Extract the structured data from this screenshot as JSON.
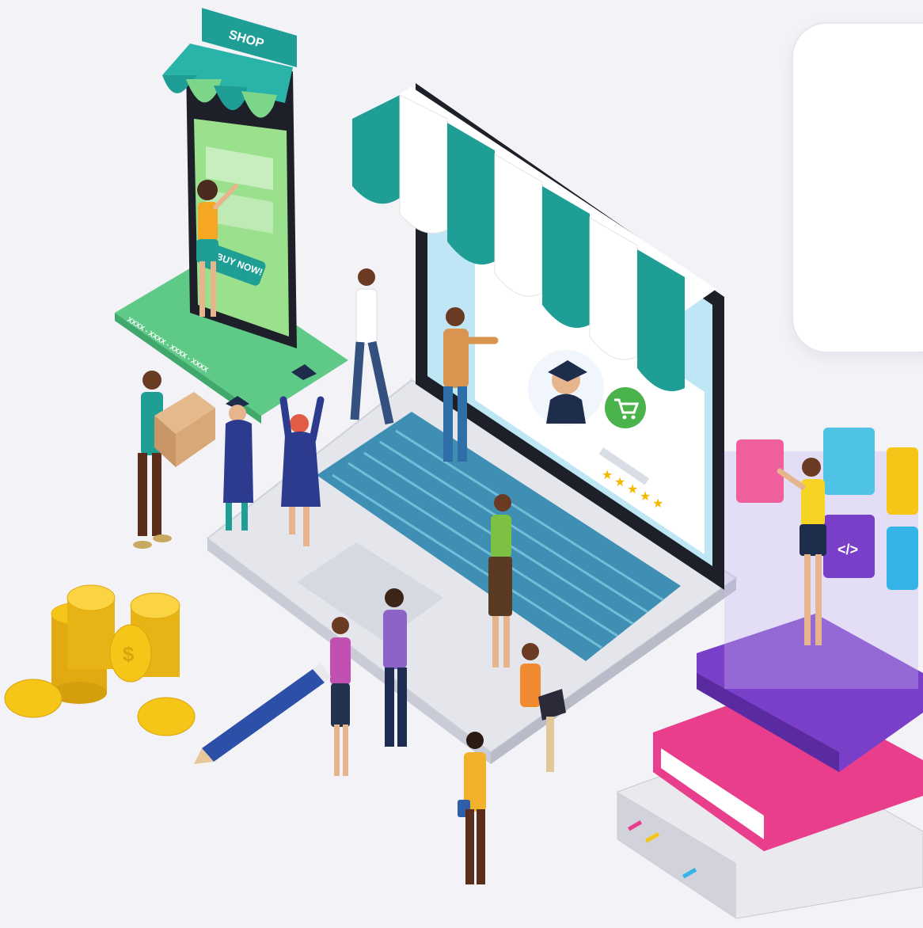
{
  "illustration": {
    "shop_sign": "SHOP",
    "buy_now_label": "BUY NOW!",
    "card_number": "XXXX - XXXX - XXXX - XXXX",
    "rating_stars": 5,
    "coin_symbol": "$"
  },
  "colors": {
    "background": "#f3f3f7",
    "awning_teal": "#1e9e95",
    "awning_white": "#ffffff",
    "phone_green": "#7cd68a",
    "keyboard_blue": "#4c9fc0",
    "coin_gold": "#f5c518",
    "book_pink": "#e83e8c",
    "book_purple": "#7a3fc8"
  },
  "callout": {
    "text": ""
  }
}
